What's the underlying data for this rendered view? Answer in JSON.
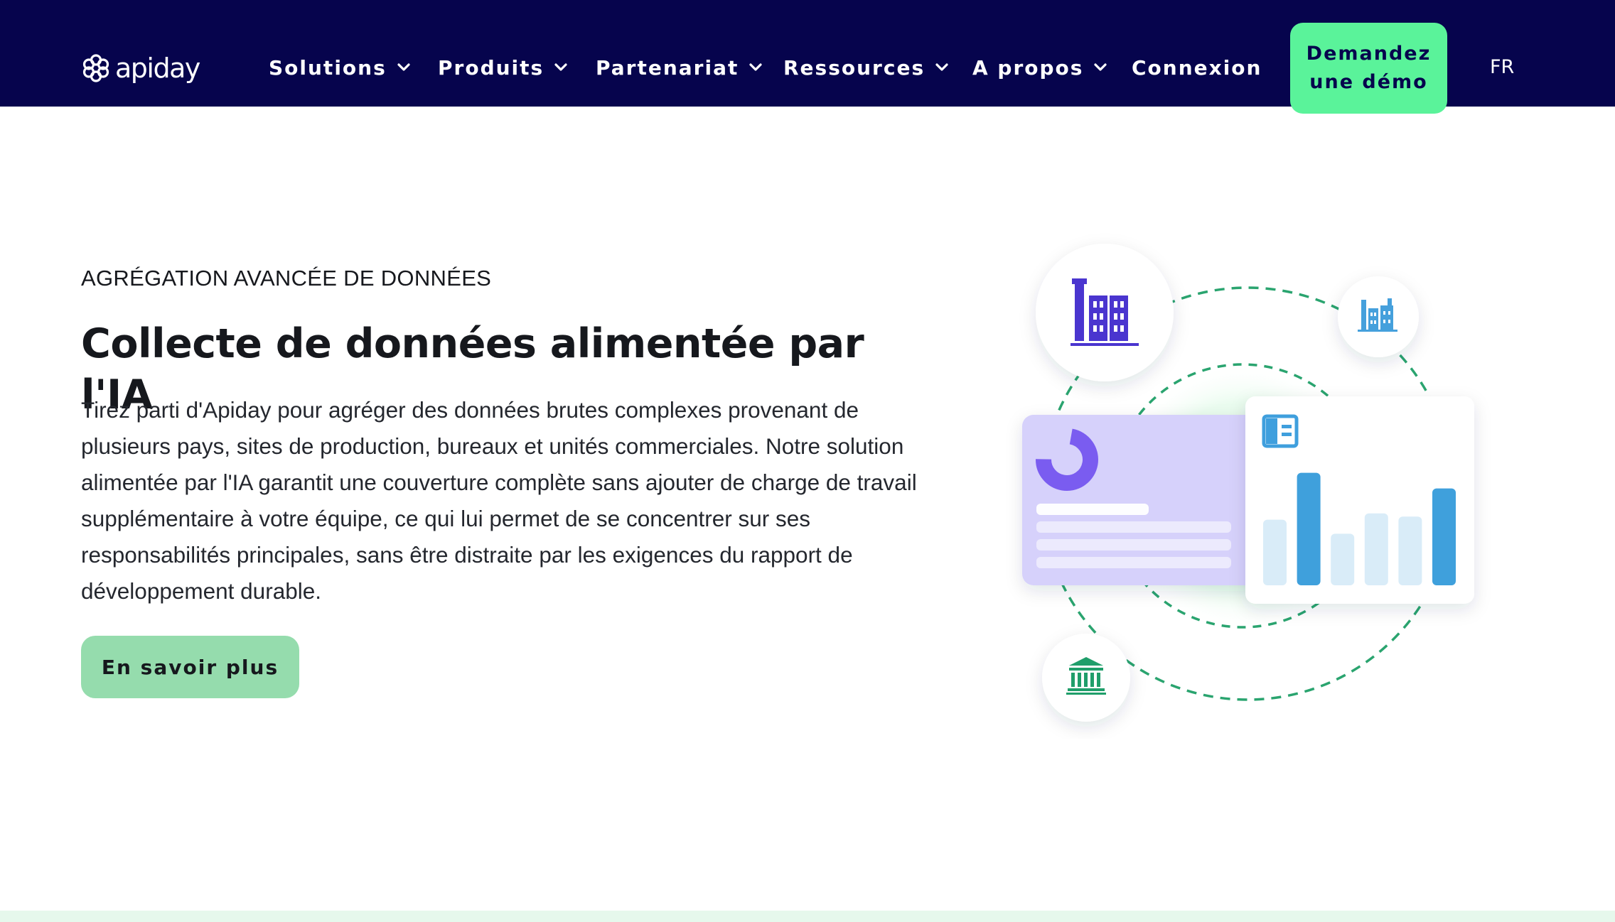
{
  "brand": {
    "name": "apiday"
  },
  "nav": {
    "items": [
      {
        "label": "Solutions",
        "has_dropdown": true
      },
      {
        "label": "Produits",
        "has_dropdown": true
      },
      {
        "label": "Partenariat",
        "has_dropdown": true
      },
      {
        "label": "Ressources",
        "has_dropdown": true
      },
      {
        "label": "A propos",
        "has_dropdown": true
      },
      {
        "label": "Connexion",
        "has_dropdown": false
      }
    ],
    "cta_label": "Demandez une démo",
    "language": "FR"
  },
  "hero": {
    "eyebrow": "AGRÉGATION AVANCÉE DE DONNÉES",
    "title": "Collecte de données alimentée par l'IA",
    "body": "Tirez parti d'Apiday pour agréger des données brutes complexes provenant de plusieurs pays, sites de production, bureaux et unités commerciales. Notre solution alimentée par l'IA garantit une couverture complète sans ajouter de charge de travail supplémentaire à votre équipe, ce qui lui permet de se concentrer sur ses responsabilités principales, sans être distraite par les exigences du rapport de développement durable.",
    "button_label": "En savoir plus"
  },
  "illustration": {
    "icons": [
      "buildings-icon",
      "factory-icon",
      "bank-icon",
      "donut-chart-icon",
      "layout-icon"
    ],
    "bar_levels": [
      0.42,
      0.72,
      0.33,
      0.46,
      0.44,
      0.62
    ]
  },
  "colors": {
    "nav_bg": "#06044d",
    "cta_bg": "#5af39a",
    "button_bg": "#95dcad",
    "accent_purple": "#5b3fd6",
    "accent_blue": "#3fa0dc",
    "accent_green": "#1f9e6a"
  }
}
